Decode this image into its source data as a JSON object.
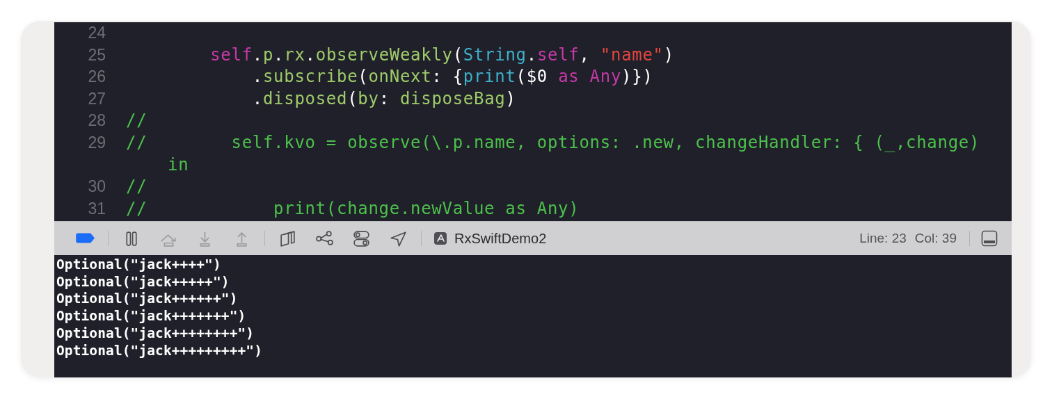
{
  "editor": {
    "lines": [
      {
        "number": "24"
      },
      {
        "number": "25",
        "tokens": [
          {
            "kind": "keyword",
            "text": "        self"
          },
          {
            "kind": "plain",
            "text": "."
          },
          {
            "kind": "method",
            "text": "p"
          },
          {
            "kind": "plain",
            "text": "."
          },
          {
            "kind": "method",
            "text": "rx"
          },
          {
            "kind": "plain",
            "text": "."
          },
          {
            "kind": "method",
            "text": "observeWeakly"
          },
          {
            "kind": "plain",
            "text": "("
          },
          {
            "kind": "type",
            "text": "String"
          },
          {
            "kind": "plain",
            "text": "."
          },
          {
            "kind": "keyword",
            "text": "self"
          },
          {
            "kind": "plain",
            "text": ", "
          },
          {
            "kind": "string",
            "text": "\"name\""
          },
          {
            "kind": "plain",
            "text": ")"
          }
        ]
      },
      {
        "number": "26",
        "tokens": [
          {
            "kind": "plain",
            "text": "            ."
          },
          {
            "kind": "method",
            "text": "subscribe"
          },
          {
            "kind": "plain",
            "text": "("
          },
          {
            "kind": "method",
            "text": "onNext"
          },
          {
            "kind": "plain",
            "text": ": {"
          },
          {
            "kind": "type",
            "text": "print"
          },
          {
            "kind": "plain",
            "text": "($0 "
          },
          {
            "kind": "keyword",
            "text": "as Any"
          },
          {
            "kind": "plain",
            "text": ")})"
          }
        ]
      },
      {
        "number": "27",
        "tokens": [
          {
            "kind": "plain",
            "text": "            ."
          },
          {
            "kind": "method",
            "text": "disposed"
          },
          {
            "kind": "plain",
            "text": "("
          },
          {
            "kind": "method",
            "text": "by"
          },
          {
            "kind": "plain",
            "text": ": "
          },
          {
            "kind": "method",
            "text": "disposeBag"
          },
          {
            "kind": "plain",
            "text": ")"
          }
        ]
      },
      {
        "number": "28",
        "tokens": [
          {
            "kind": "comment",
            "text": "//"
          }
        ]
      },
      {
        "number": "29",
        "tokens": [
          {
            "kind": "comment",
            "text": "//        self.kvo = observe(\\.p.name, options: .new, changeHandler: { (_,change)"
          }
        ]
      },
      {
        "tokens": [
          {
            "kind": "comment",
            "text": "in"
          }
        ]
      },
      {
        "number": "30",
        "tokens": [
          {
            "kind": "comment",
            "text": "//"
          }
        ]
      },
      {
        "number": "31",
        "tokens": [
          {
            "kind": "comment",
            "text": "//            print(change.newValue as Any)"
          }
        ]
      }
    ]
  },
  "debug_bar": {
    "items": [
      {
        "kind": "breakpoints",
        "on": true
      },
      {
        "kind": "separator"
      },
      {
        "kind": "pause",
        "disabled": false
      },
      {
        "kind": "step_over",
        "disabled": true
      },
      {
        "kind": "step_into",
        "disabled": true
      },
      {
        "kind": "step_out",
        "disabled": true
      },
      {
        "kind": "separator"
      },
      {
        "kind": "view_hierarchy",
        "disabled": false
      },
      {
        "kind": "memory_graph",
        "disabled": false
      },
      {
        "kind": "environment",
        "disabled": false
      },
      {
        "kind": "location",
        "disabled": false
      },
      {
        "kind": "separator"
      },
      {
        "kind": "target",
        "label": "RxSwiftDemo2"
      }
    ],
    "line": "Line: 23",
    "column": "Col: 39"
  },
  "console": {
    "lines": [
      "Optional(\"jack++++\")",
      "Optional(\"jack+++++\")",
      "Optional(\"jack++++++\")",
      "Optional(\"jack+++++++\")",
      "Optional(\"jack++++++++\")",
      "Optional(\"jack+++++++++\")"
    ]
  }
}
